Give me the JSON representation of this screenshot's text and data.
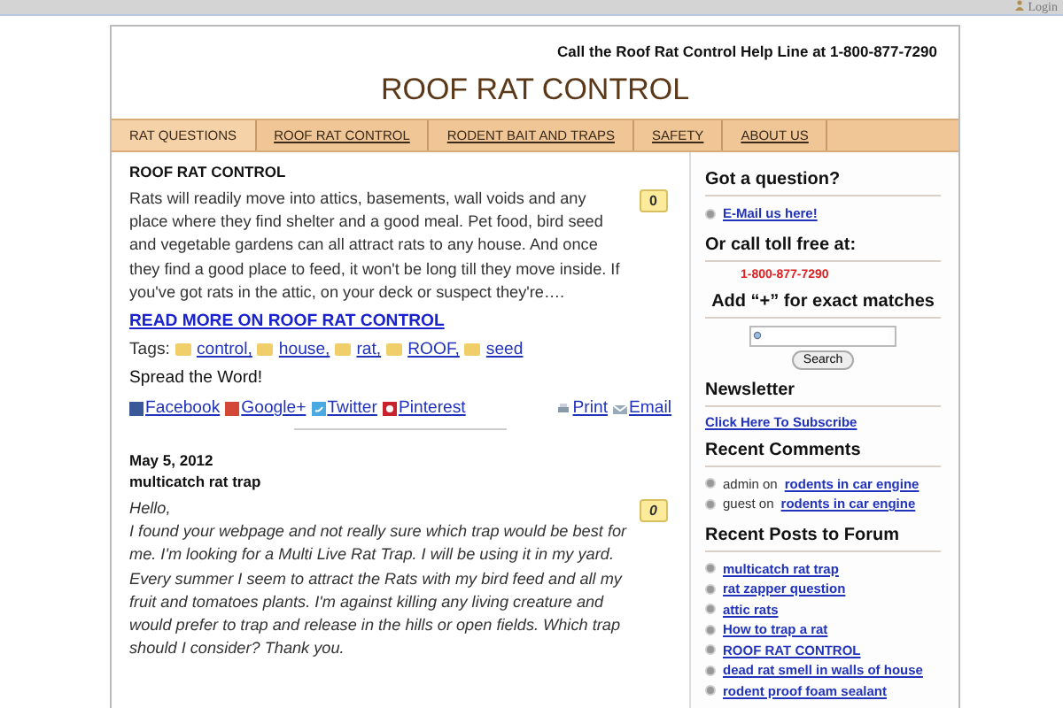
{
  "top_bar": {
    "login": "Login"
  },
  "header": {
    "help_line": "Call the Roof Rat Control Help Line at 1-800-877-7290",
    "title": "ROOF RAT CONTROL"
  },
  "nav": [
    {
      "label": "RAT QUESTIONS",
      "selected": true
    },
    {
      "label": "ROOF RAT CONTROL",
      "selected": false
    },
    {
      "label": "RODENT BAIT AND TRAPS",
      "selected": false
    },
    {
      "label": "SAFETY",
      "selected": false
    },
    {
      "label": "ABOUT US",
      "selected": false
    }
  ],
  "posts": [
    {
      "title": "ROOF RAT CONTROL",
      "comment_count": "0",
      "italic": false,
      "paragraphs": [
        "Rats will readily move into attics, basements, wall voids and any place where they find shelter and a good meal. Pet food, bird seed and vegetable gardens can all attract rats to any house. And once they find a good place to feed, it won't be long till they move inside. If you've got rats in the attic, on your deck or suspect they're…."
      ],
      "read_more": "READ MORE ON ROOF RAT CONTROL",
      "tags_label": "Tags:",
      "tags": [
        "control,",
        "house,",
        "rat,",
        "ROOF,",
        "seed"
      ],
      "spread": "Spread the Word!",
      "share": [
        {
          "kind": "facebook",
          "label": "Facebook"
        },
        {
          "kind": "google",
          "label": "Google+"
        },
        {
          "kind": "twitter",
          "label": "Twitter"
        },
        {
          "kind": "pinterest",
          "label": "Pinterest"
        }
      ],
      "tools": [
        {
          "kind": "print",
          "label": "Print"
        },
        {
          "kind": "email",
          "label": "Email"
        }
      ]
    },
    {
      "date": "May 5, 2012",
      "title": "multicatch rat trap",
      "comment_count": "0",
      "italic": true,
      "paragraphs": [
        "Hello,",
        "I found your webpage and not really sure which trap would be best for me. I'm looking for a Multi Live Rat Trap. I will be using it in my yard. Every summer I seem to attract the Rats with my bird feed and all my fruit and tomatoes plants. I'm against killing any living creature and would prefer to trap and release in the hills or open fields. Which trap should I consider? Thank you."
      ]
    }
  ],
  "sidebar": [
    {
      "kind": "links",
      "heading": "Got a question?",
      "items": [
        {
          "link": "E-Mail us here!"
        }
      ]
    },
    {
      "kind": "phone",
      "heading": "Or call toll free at:",
      "phone": "1-800-877-7290"
    },
    {
      "kind": "search",
      "heading": "Add “+” for exact matches",
      "button": "Search"
    },
    {
      "kind": "plain",
      "heading": "Newsletter",
      "link": "Click Here To Subscribe"
    },
    {
      "kind": "links",
      "heading": "Recent Comments",
      "items": [
        {
          "author": "admin",
          "joiner": "on",
          "link": "rodents in car engine"
        },
        {
          "author": "guest",
          "joiner": "on",
          "link": "rodents in car engine"
        }
      ]
    },
    {
      "kind": "links",
      "heading": "Recent Posts to Forum",
      "items": [
        {
          "link": "multicatch rat trap"
        },
        {
          "link": "rat zapper question"
        },
        {
          "link": "attic rats"
        },
        {
          "link": "How to trap a rat"
        },
        {
          "link": "ROOF RAT CONTROL"
        },
        {
          "link": "dead rat smell in walls of house"
        },
        {
          "link": "rodent proof foam sealant"
        }
      ]
    }
  ]
}
